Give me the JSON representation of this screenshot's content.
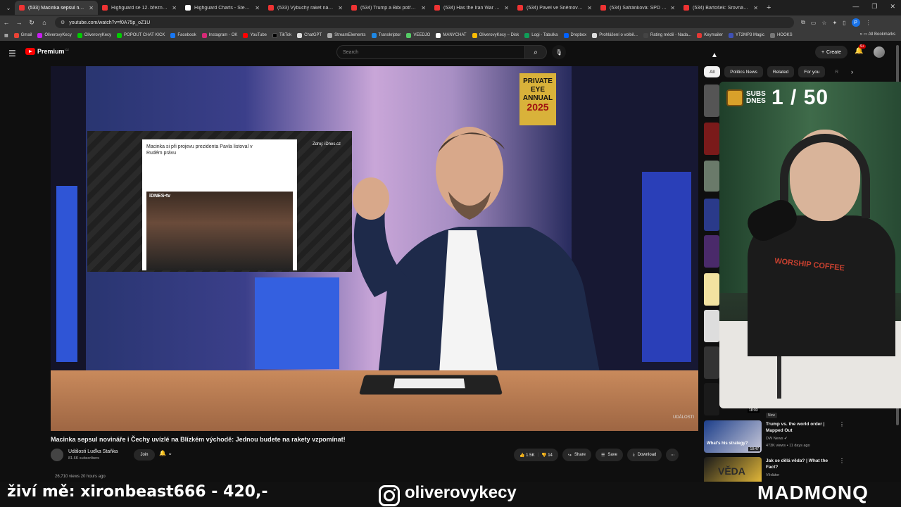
{
  "browser": {
    "tabs": [
      {
        "title": "(533) Macinka sepsul novi...",
        "active": true
      },
      {
        "title": "Highguard se 12. března defini..."
      },
      {
        "title": "Highguard Charts - SteamDB"
      },
      {
        "title": "(533) Výbuchy raket nás budí z..."
      },
      {
        "title": "(534) Trump a Bibi potřebují vál..."
      },
      {
        "title": "(534) Has the Iran War Created..."
      },
      {
        "title": "(534) Pavel ve Sněmovně: Nem..."
      },
      {
        "title": "(534) Šafránková: SPD v tuto ch..."
      },
      {
        "title": "(534) Bartošek: Srovnávat Írán s..."
      }
    ],
    "new_tab": "+",
    "url": "youtube.com/watch?v=f0A75p_oZ1U",
    "profile_initial": "P",
    "bookmarks": [
      "Gmail",
      "OliverovyKecy",
      "OliverovyKecy",
      "POPOUT CHAT KICK",
      "Facebook",
      "Instagram - OK",
      "YouTube",
      "TikTok",
      "ChatGPT",
      "StreamElements",
      "Transkriptor",
      "VEEDJO",
      "MANYCHAT",
      "OliverovyKecy – Disk",
      "Logi - Tabulka",
      "Dropbox",
      "Prohlášení o volbě...",
      "Rating médií - Nada...",
      "Keymailer",
      "YT2MP3 Magic",
      "HOOKS"
    ],
    "all_bookmarks": "All Bookmarks"
  },
  "youtube": {
    "logo_text": "Premium",
    "region": "CZ",
    "search_placeholder": "Search",
    "create_label": "Create",
    "notif_count": "9+",
    "video": {
      "article_title": "Macinka si při projevu prezidenta Pavla listoval v Rudém právu",
      "source": "Zdroj: iDnes.cz",
      "tv_label": "iDNES•tv",
      "book_line1": "PRIVATE EYE",
      "book_line2": "ANNUAL",
      "book_year": "2025",
      "watermark": "UDÁLOSTI"
    },
    "title": "Macinka sepsul novináře i Čechy uvízlé na Blízkém východě: Jednou budete na rakety vzpomínat!",
    "channel": "Události Luďka Staňka",
    "subscribers": "81.6K subscribers",
    "join_label": "Join",
    "likes": "1.5K",
    "dislikes": "14",
    "share_label": "Share",
    "save_label": "Save",
    "download_label": "Download",
    "meta": "26,710 views  20 hours ago",
    "chips": [
      "All",
      "Politics News",
      "Related",
      "For you",
      "R"
    ],
    "sidebar": [
      {
        "title": "Trump vs. the world order | Mapped Out",
        "channel": "DW News",
        "views": "473K views • 11 days ago",
        "duration": "18:47",
        "thumb_text": "What's his strategy?"
      },
      {
        "title": "Jak se dělá věda? | What the Fact?",
        "channel": "Vědátor",
        "views": "",
        "thumb_text": "VĚDA"
      }
    ],
    "new_badge": "New",
    "dur_prev": "18:03"
  },
  "webcam": {
    "subs_label": "SUBS DNES",
    "count": "1 / 50",
    "shirt_text": "WORSHIP COFFEE"
  },
  "stream": {
    "left": "živí mě: xironbeast666 - 420,-",
    "instagram": "oliverovykecy",
    "right": "MADMONQ"
  },
  "colors": {
    "yt_red": "#ff0000",
    "bg": "#0f0f0f"
  }
}
